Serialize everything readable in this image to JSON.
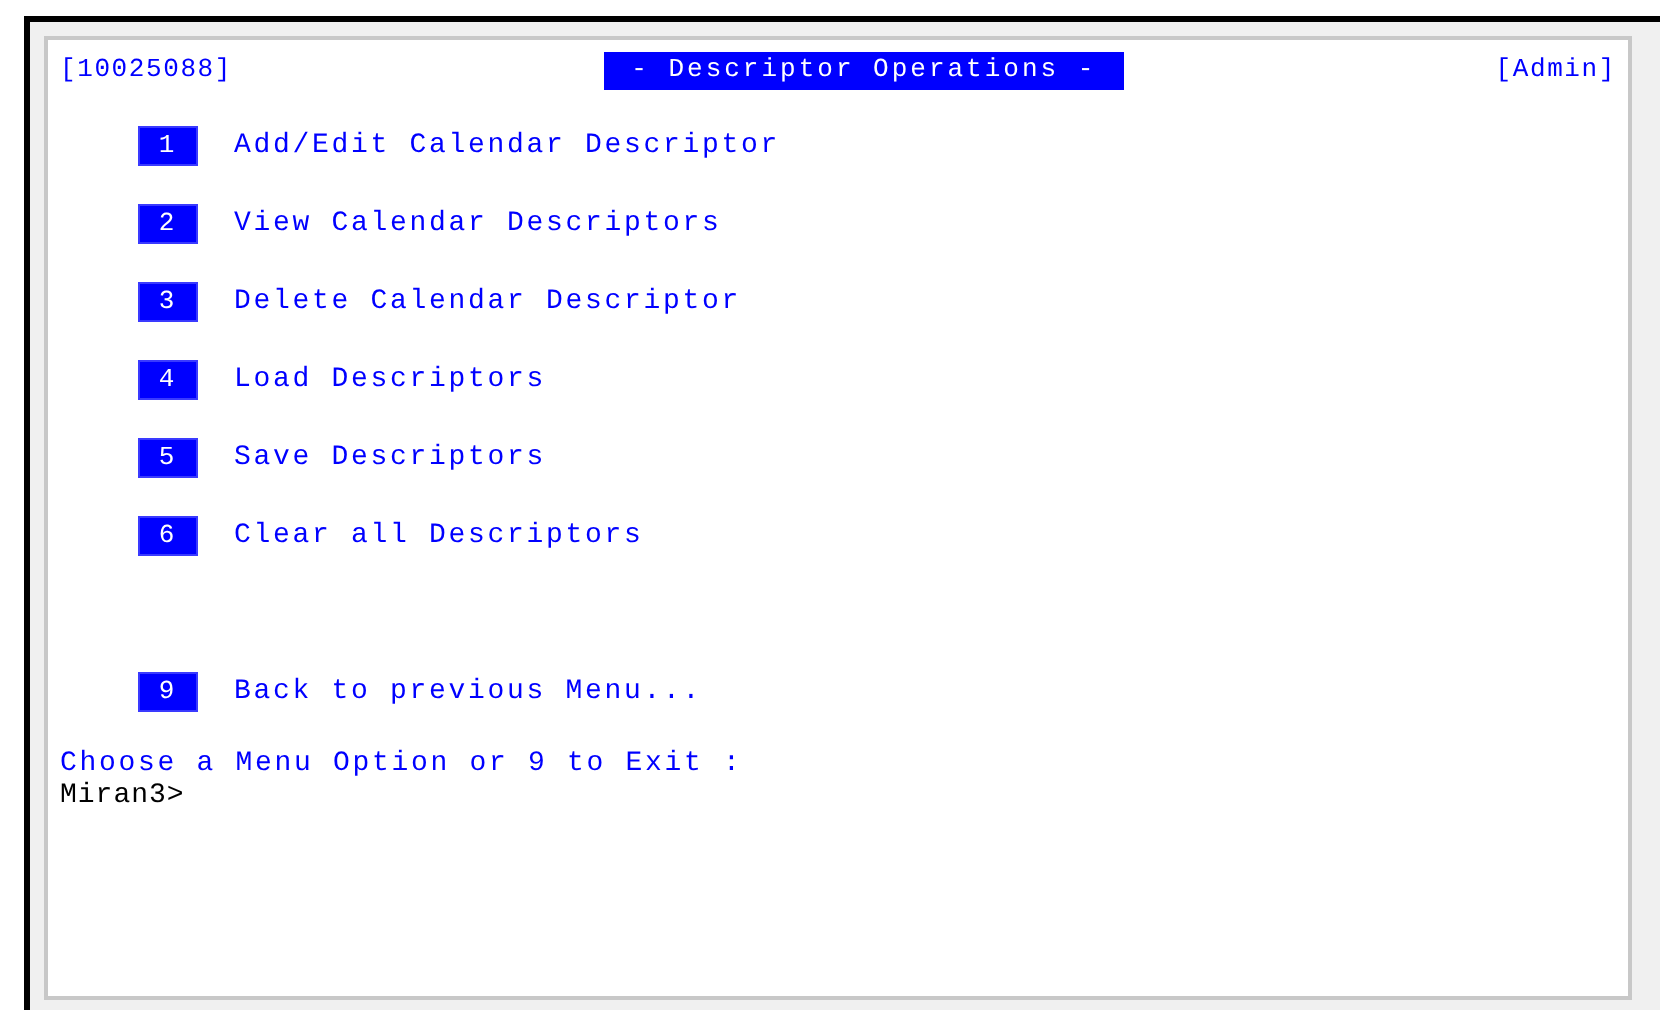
{
  "header": {
    "session_id": "[10025088]",
    "title": "- Descriptor Operations -",
    "role": "[Admin]"
  },
  "options": [
    {
      "key": "1",
      "label": "Add/Edit Calendar Descriptor"
    },
    {
      "key": "2",
      "label": "View Calendar Descriptors"
    },
    {
      "key": "3",
      "label": "Delete Calendar Descriptor"
    },
    {
      "key": "4",
      "label": "Load Descriptors"
    },
    {
      "key": "5",
      "label": "Save Descriptors"
    },
    {
      "key": "6",
      "label": "Clear all Descriptors"
    }
  ],
  "exit_option": {
    "key": "9",
    "label": "Back to previous Menu..."
  },
  "prompt": "Choose a Menu Option or 9 to Exit :",
  "command_line": "Miran3>"
}
